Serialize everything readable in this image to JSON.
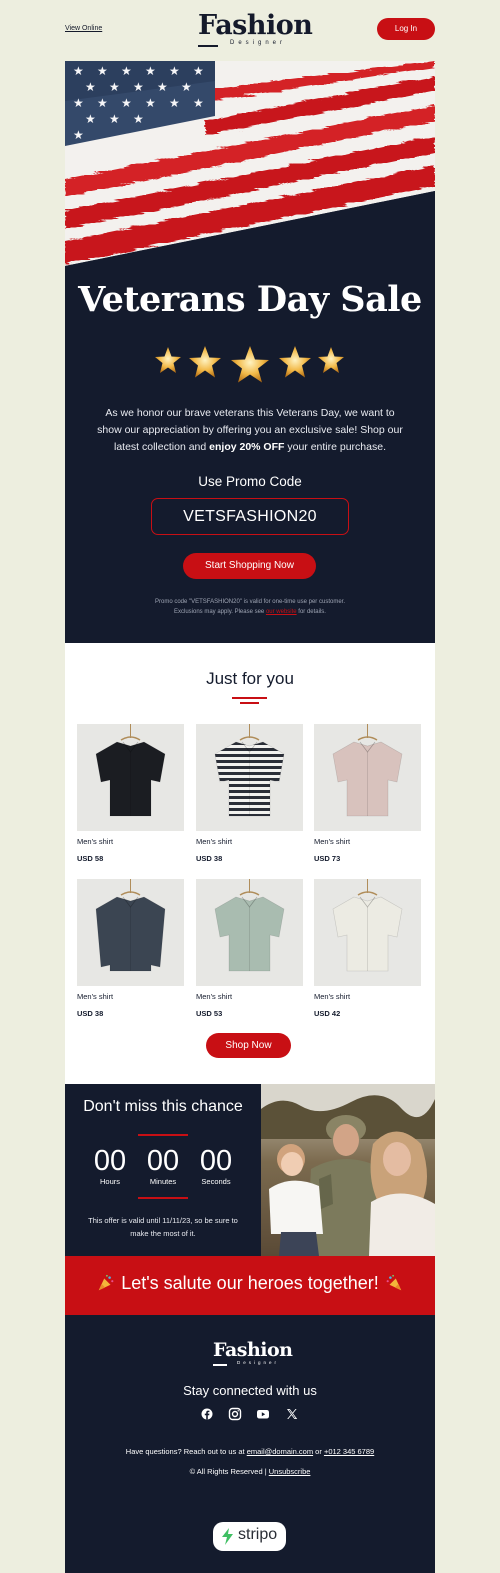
{
  "header": {
    "view_online": "View Online",
    "logo_word": "Fashion",
    "logo_sub": "Designer",
    "login_label": "Log In"
  },
  "hero": {
    "title": "Veterans Day Sale",
    "star_count": 5,
    "text_part1": "As we honor our brave veterans this Veterans Day, we want to show our appreciation by offering you an exclusive sale!  Shop our latest collection and ",
    "text_bold": "enjoy 20% OFF",
    "text_part2": " your entire purchase.",
    "promo_label": "Use Promo Code",
    "promo_code": "VETSFASHION20",
    "cta_label": "Start Shopping Now",
    "fine_print_1": "Promo code \"VETSFASHION20\" is valid for one-time use per customer.",
    "fine_print_2a": "Exclusions may apply. Please see ",
    "fine_print_link": "our website",
    "fine_print_2b": " for details."
  },
  "products_section": {
    "title": "Just for you",
    "items": [
      {
        "name": "Men's shirt",
        "price": "USD 58",
        "color": "#1b1d22"
      },
      {
        "name": "Men's shirt",
        "price": "USD 38",
        "color": "#2b2f38"
      },
      {
        "name": "Men's shirt",
        "price": "USD 73",
        "color": "#d8c2bd"
      },
      {
        "name": "Men's shirt",
        "price": "USD 38",
        "color": "#3b4552"
      },
      {
        "name": "Men's shirt",
        "price": "USD 53",
        "color": "#a9bcb0"
      },
      {
        "name": "Men's shirt",
        "price": "USD 42",
        "color": "#ecebe3"
      }
    ],
    "cta_label": "Shop Now"
  },
  "countdown": {
    "title": "Don't miss this chance",
    "hours": "00",
    "minutes": "00",
    "seconds": "00",
    "hours_label": "Hours",
    "minutes_label": "Minutes",
    "seconds_label": "Seconds",
    "note": "This offer is valid until 11/11/23, so be sure to make the most of it."
  },
  "banner": {
    "text": "Let's salute our heroes together!"
  },
  "footer": {
    "logo_word": "Fashion",
    "logo_sub": "Designer",
    "stay_connected": "Stay connected with us",
    "socials": [
      "facebook-icon",
      "instagram-icon",
      "youtube-icon",
      "x-icon"
    ],
    "questions_prefix": "Have questions? Reach out to us at ",
    "email": "email@domain.com",
    "questions_or": " or ",
    "phone": "+012 345 6789",
    "rights_prefix": "© All Rights Reserved | ",
    "unsubscribe": "Unsubscribe",
    "stripo_label": "stripo"
  },
  "colors": {
    "accent": "#c80f14",
    "navy": "#141b2d",
    "page_bg": "#edeedf"
  }
}
